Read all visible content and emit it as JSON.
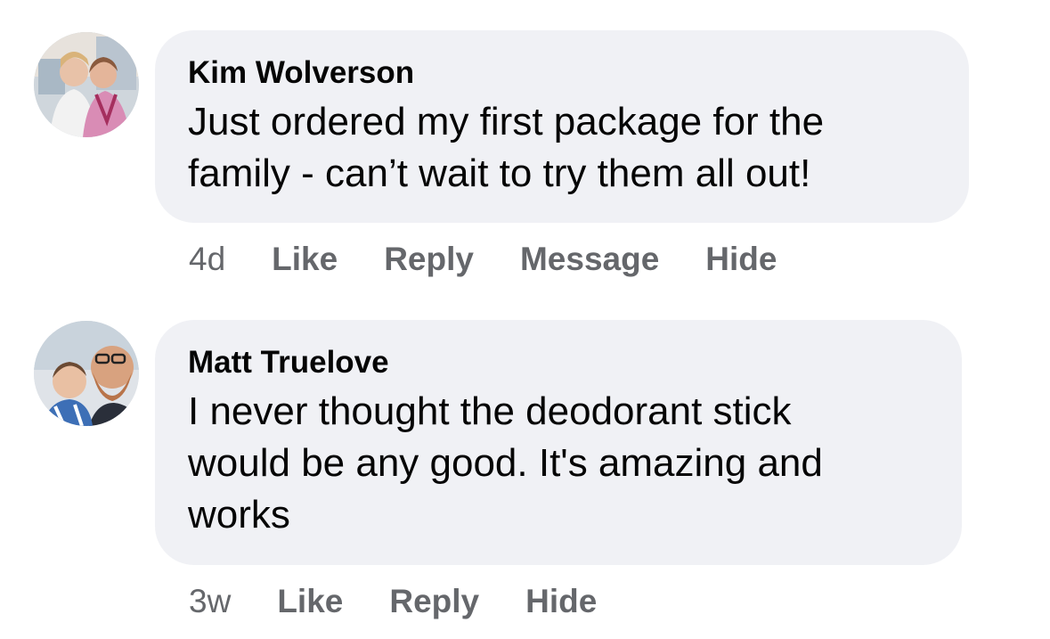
{
  "comments": [
    {
      "author": "Kim Wolverson",
      "text_lines": [
        "Just ordered my first package for the",
        "family - can’t wait to try them all out!"
      ],
      "time": "4d",
      "actions": [
        "Like",
        "Reply",
        "Message",
        "Hide"
      ]
    },
    {
      "author": "Matt Truelove",
      "text_lines": [
        "I never thought the deodorant stick",
        "would be any good. It's amazing and",
        "works"
      ],
      "time": "3w",
      "actions": [
        "Like",
        "Reply",
        "Hide"
      ]
    }
  ]
}
